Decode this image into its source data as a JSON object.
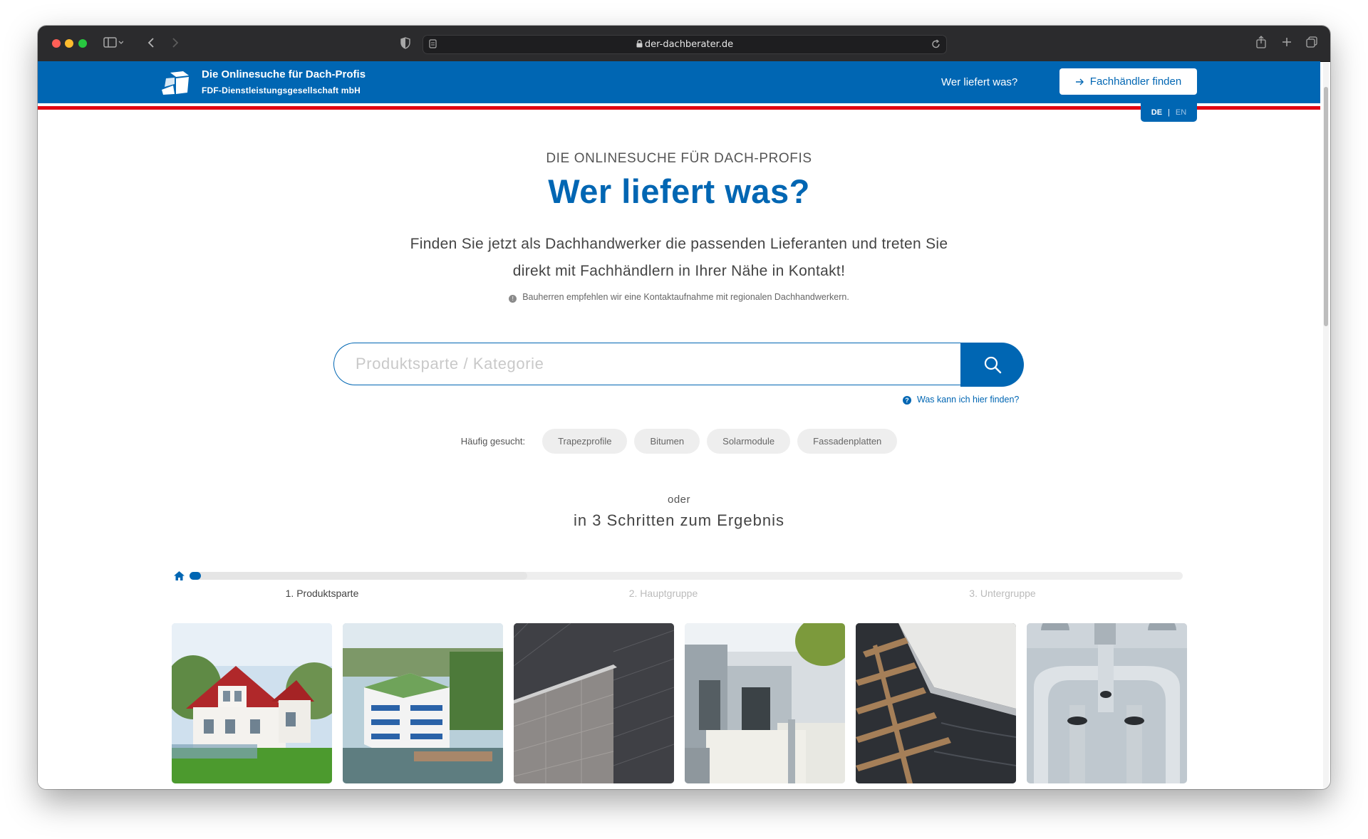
{
  "browser": {
    "url": "der-dachberater.de"
  },
  "header": {
    "brand_title": "Die Onlinesuche für Dach-Profis",
    "brand_subtitle": "FDF-Dienstleistungsgesellschaft mbH",
    "nav_link": "Wer liefert was?",
    "dealer_button": "Fachhändler finden",
    "lang_de": "DE",
    "lang_en": "EN",
    "lang_sep": "|"
  },
  "hero": {
    "kicker": "DIE ONLINESUCHE FÜR DACH-PROFIS",
    "headline": "Wer liefert was?",
    "intro_line1": "Finden Sie jetzt als Dachhandwerker die passenden Lieferanten und treten Sie",
    "intro_line2": "direkt mit Fachhändlern in Ihrer Nähe in Kontakt!",
    "hint": "Bauherren empfehlen wir eine Kontaktaufnahme mit regionalen Dachhandwerkern."
  },
  "search": {
    "placeholder": "Produktsparte / Kategorie",
    "help_link": "Was kann ich hier finden?"
  },
  "popular": {
    "label": "Häufig gesucht:",
    "chips": [
      "Trapezprofile",
      "Bitumen",
      "Solarmodule",
      "Fassadenplatten"
    ]
  },
  "steps": {
    "oder": "oder",
    "title": "in 3 Schritten zum Ergebnis",
    "progress": 0.34,
    "labels": [
      "1. Produktsparte",
      "2. Hauptgruppe",
      "3. Untergruppe"
    ]
  },
  "tiles": [
    {
      "name": "house-photo"
    },
    {
      "name": "flat-roof-building-photo"
    },
    {
      "name": "slate-facade-photo"
    },
    {
      "name": "metal-facade-photo"
    },
    {
      "name": "roof-tiles-photo"
    },
    {
      "name": "gutter-parts-photo"
    }
  ],
  "colors": {
    "brand_blue": "#0066b3",
    "brand_red": "#e30613"
  }
}
